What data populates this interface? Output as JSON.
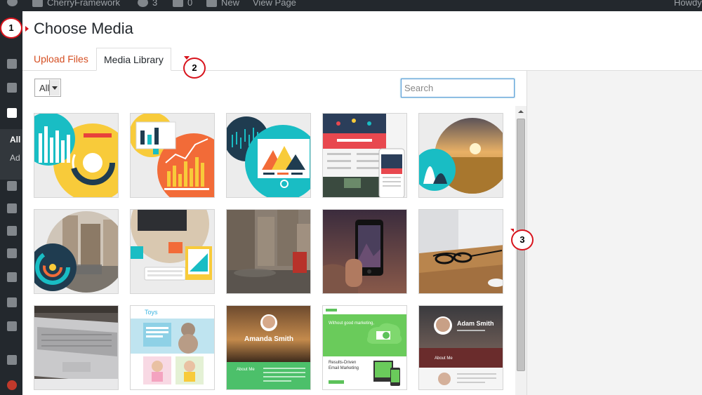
{
  "adminbar": {
    "site_name": "CherryFramework",
    "updates_count": "3",
    "comments_count": "0",
    "new_label": "New",
    "view_page_label": "View Page",
    "howdy_label": "Howdy"
  },
  "sidemenu": {
    "all_label": "All",
    "add_label": "Ad"
  },
  "modal": {
    "title": "Choose Media",
    "tabs": [
      {
        "label": "Upload Files"
      },
      {
        "label": "Media Library"
      }
    ],
    "filter": {
      "selected": "All"
    },
    "search": {
      "placeholder": "Search"
    }
  },
  "thumbnails": [
    {
      "name": "circle-bar-chart-graphic"
    },
    {
      "name": "monitor-chart-graphic"
    },
    {
      "name": "mountain-card-graphic"
    },
    {
      "name": "mobile-site-mockup"
    },
    {
      "name": "field-sunset-circle"
    },
    {
      "name": "city-street-circle"
    },
    {
      "name": "desk-keyboard-photo"
    },
    {
      "name": "city-street-photo"
    },
    {
      "name": "phone-in-hand-photo"
    },
    {
      "name": "glasses-on-desk-photo"
    },
    {
      "name": "laptop-photo"
    },
    {
      "name": "toys-store-mockup"
    },
    {
      "name": "amanda-smith-mockup"
    },
    {
      "name": "email-marketing-mockup"
    },
    {
      "name": "adam-smith-mockup"
    }
  ],
  "site_text": {
    "amanda_name": "Amanda Smith",
    "amanda_about": "About Me",
    "adam_name": "Adam Smith",
    "adam_about": "About Me",
    "toys_title": "Toys",
    "email_headline": "Without good marketing,",
    "email_sub": "Results-Driven",
    "email_sub2": "Email Marketing"
  },
  "callouts": [
    "1",
    "2",
    "3"
  ],
  "colors": {
    "admin_dark": "#23282d",
    "link_orange": "#d54e21",
    "callout_red": "#d8141d",
    "focus_blue": "#5b9dd9"
  }
}
